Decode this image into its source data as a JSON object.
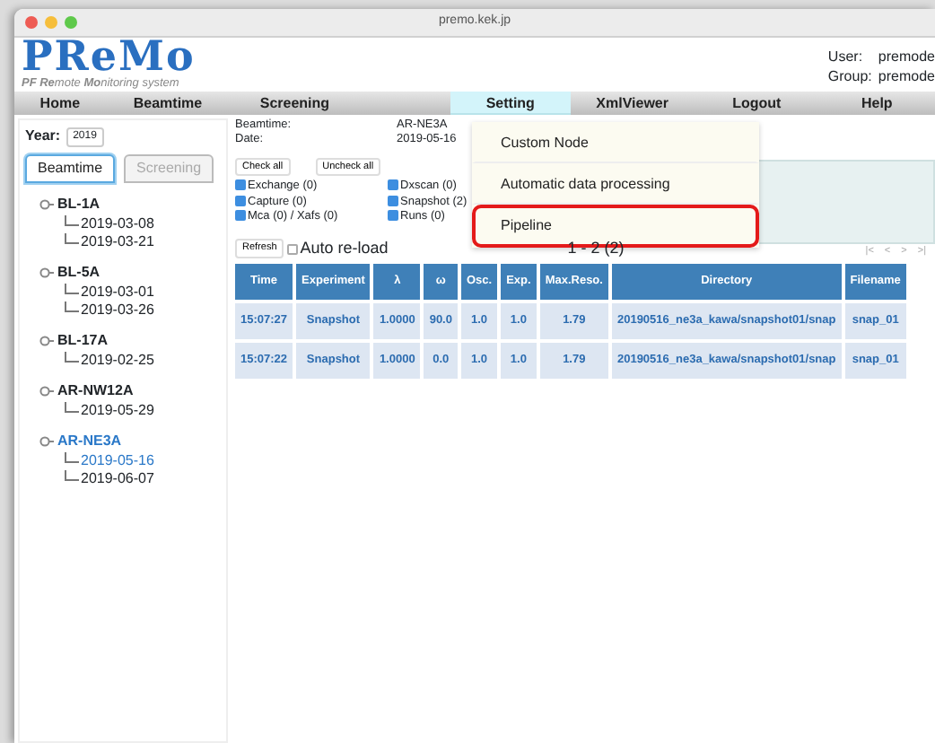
{
  "browser": {
    "address": "premo.kek.jp"
  },
  "logo": {
    "title": "PReMo",
    "subtitle": "**PF Re**mote **Mo**nitoring system"
  },
  "account": [
    {
      "label": "User:",
      "value": "premode"
    },
    {
      "label": "Group:",
      "value": "premode"
    }
  ],
  "nav": [
    {
      "label": "Home",
      "selected": false
    },
    {
      "label": "Beamtime",
      "selected": false
    },
    {
      "label": "Screening",
      "selected": false
    },
    {
      "label": "Setting",
      "selected": true
    },
    {
      "label": "XmlViewer",
      "selected": false
    },
    {
      "label": "Logout",
      "selected": false
    },
    {
      "label": "Help",
      "selected": false
    }
  ],
  "menu": [
    {
      "label": "Custom Node",
      "highlighted": false
    },
    {
      "label": "Automatic data processing",
      "highlighted": false
    },
    {
      "label": "Pipeline",
      "highlighted": true
    }
  ],
  "sidebar": {
    "year_label": "Year:",
    "year_value": "2019",
    "tabs": [
      {
        "label": "Beamtime",
        "selected": true
      },
      {
        "label": "Screening",
        "selected": false
      }
    ],
    "tree": [
      {
        "label": "BL-1A",
        "selected": false,
        "children": [
          {
            "label": "2019-03-08",
            "selected": false
          },
          {
            "label": "2019-03-21",
            "selected": false
          }
        ]
      },
      {
        "label": "BL-5A",
        "selected": false,
        "children": [
          {
            "label": "2019-03-01",
            "selected": false
          },
          {
            "label": "2019-03-26",
            "selected": false
          }
        ]
      },
      {
        "label": "BL-17A",
        "selected": false,
        "children": [
          {
            "label": "2019-02-25",
            "selected": false
          }
        ]
      },
      {
        "label": "AR-NW12A",
        "selected": false,
        "children": [
          {
            "label": "2019-05-29",
            "selected": false
          }
        ]
      },
      {
        "label": "AR-NE3A",
        "selected": true,
        "children": [
          {
            "label": "2019-05-16",
            "selected": true
          },
          {
            "label": "2019-06-07",
            "selected": false
          }
        ]
      }
    ]
  },
  "info": [
    {
      "label": "Beamtime:",
      "value": "AR-NE3A"
    },
    {
      "label": "Date:",
      "value": "2019-05-16"
    }
  ],
  "check_buttons": [
    "Check all",
    "Uncheck all"
  ],
  "filters": [
    {
      "label": "Exchange (0)",
      "checked": true
    },
    {
      "label": "Dxscan (0)",
      "checked": true
    },
    {
      "label": "Capture (0)",
      "checked": true
    },
    {
      "label": "Snapshot (2)",
      "checked": true
    },
    {
      "label": "Mca (0) / Xafs (0)",
      "checked": true
    },
    {
      "label": "Runs (0)",
      "checked": true
    }
  ],
  "refresh": "Refresh",
  "auto_reload": {
    "label": "Auto re-load",
    "checked": false
  },
  "pagination": {
    "range": "1 - 2 (2)",
    "buttons": [
      "|<",
      "<",
      ">",
      ">|"
    ]
  },
  "table": {
    "columns": [
      "Time",
      "Experiment",
      "λ",
      "ω",
      "Osc.",
      "Exp.",
      "Max.Reso.",
      "Directory",
      "Filename"
    ],
    "rows": [
      [
        "15:07:27",
        "Snapshot",
        "1.0000",
        "90.0",
        "1.0",
        "1.0",
        "1.79",
        "20190516_ne3a_kawa/snapshot01/snap",
        "snap_01"
      ],
      [
        "15:07:22",
        "Snapshot",
        "1.0000",
        "0.0",
        "1.0",
        "1.0",
        "1.79",
        "20190516_ne3a_kawa/snapshot01/snap",
        "snap_01"
      ]
    ]
  }
}
